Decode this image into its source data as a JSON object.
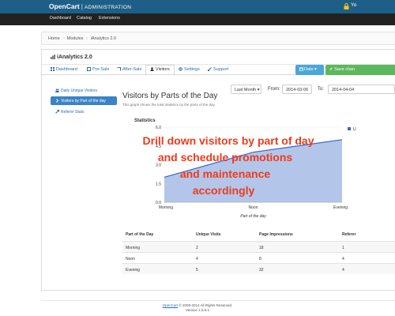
{
  "header": {
    "brand": "OpenCart",
    "sub": "ADMINISTRATION",
    "user": "Yo"
  },
  "menu": [
    "Dashboard",
    "Catalog",
    "Extensions"
  ],
  "breadcrumb": [
    "Home",
    "Modules",
    "iAnalytics 2.0"
  ],
  "panel": {
    "title": "iAnalytics 2.0"
  },
  "tabs": [
    "Dashboard",
    "Pre-Sale",
    "After-Sale",
    "Visitors",
    "Settings",
    "Support"
  ],
  "actions": {
    "date": "Date",
    "save": "Save chan"
  },
  "sidebar": [
    "Daily Unique Visitors",
    "Visitors by Part of the day",
    "Referer Stats"
  ],
  "section": {
    "title": "Visitors by Parts of the Day",
    "subtitle": "This graph shows the total statistics by the parts of the day."
  },
  "filters": {
    "range": "Last Month",
    "from_label": "From:",
    "from": "2014-03-06",
    "to_label": "To:",
    "to": "2014-04-04"
  },
  "chart_data": {
    "type": "area",
    "title": "Statistics",
    "xlabel": "Part of the day",
    "ylabel": "",
    "categories": [
      "Morning",
      "Noon",
      "Evening"
    ],
    "series": [
      {
        "name": "U",
        "values": [
          2,
          4,
          5
        ]
      }
    ],
    "ylim": [
      0,
      6
    ],
    "yticks": [
      "0.0",
      "1.5",
      "3.0",
      "4.5",
      "6.0"
    ],
    "legend": "top-right",
    "color": "#3466cc",
    "fill": "#b3c6ea"
  },
  "overlay": [
    "Drill down visitors by part of day",
    "and schedule promotions",
    "and maintenance",
    "accordingly"
  ],
  "table": {
    "headers": [
      "Part of the Day",
      "Unique Visits",
      "Page Impressions",
      "Referer"
    ],
    "rows": [
      [
        "Morning",
        "2",
        "18",
        "1"
      ],
      [
        "Noon",
        "4",
        "8",
        "4"
      ],
      [
        "Evening",
        "5",
        "32",
        "4"
      ]
    ]
  },
  "footer": {
    "link": "OpenCart",
    "copy": "© 2009-2014 All Rights Reserved.",
    "version": "Version 1.5.6.1"
  }
}
